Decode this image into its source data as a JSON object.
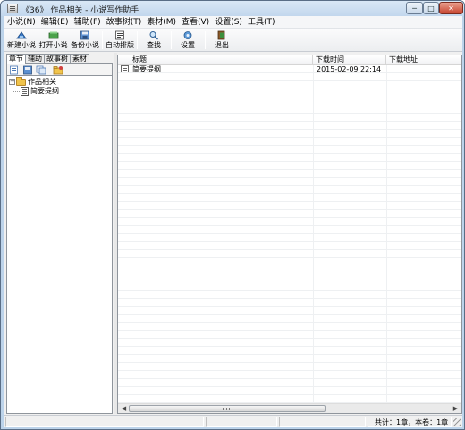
{
  "window": {
    "title": "《36》 作品相关 - 小说写作助手",
    "minimize_label": "─",
    "maximize_label": "□",
    "close_label": "✕"
  },
  "menu": [
    {
      "label": "小说(N)"
    },
    {
      "label": "编辑(E)"
    },
    {
      "label": "辅助(F)"
    },
    {
      "label": "故事树(T)"
    },
    {
      "label": "素材(M)"
    },
    {
      "label": "查看(V)"
    },
    {
      "label": "设置(S)"
    },
    {
      "label": "工具(T)"
    }
  ],
  "toolbar": {
    "new_novel": {
      "label": "新建小说",
      "icon": "new-novel-icon"
    },
    "open_novel": {
      "label": "打开小说",
      "icon": "open-novel-icon"
    },
    "backup_novel": {
      "label": "备份小说",
      "icon": "backup-icon"
    },
    "auto_format": {
      "label": "自动排版",
      "icon": "auto-format-icon"
    },
    "find": {
      "label": "查找",
      "icon": "find-icon"
    },
    "settings": {
      "label": "设置",
      "icon": "settings-icon"
    },
    "exit": {
      "label": "退出",
      "icon": "exit-icon"
    }
  },
  "left_panel": {
    "tabs": [
      {
        "label": "章节",
        "active": true
      },
      {
        "label": "辅助",
        "active": false
      },
      {
        "label": "故事树",
        "active": false
      },
      {
        "label": "素材",
        "active": false
      }
    ],
    "tree": {
      "root": {
        "label": "作品相关",
        "expander": "−"
      },
      "children": [
        {
          "label": "简要提纲"
        }
      ]
    }
  },
  "list": {
    "columns": [
      "标题",
      "下载时间",
      "下载地址"
    ],
    "rows": [
      {
        "title": "简要提纲",
        "time": "2015-02-09 22:14",
        "url": ""
      }
    ],
    "scroll_left": "◀",
    "scroll_right": "▶"
  },
  "status": {
    "summary": "共计：1章，本卷：1章"
  },
  "colors": {
    "titlebar": "#c2d7ed",
    "close_button": "#c7442f",
    "folder": "#f0c44c"
  }
}
